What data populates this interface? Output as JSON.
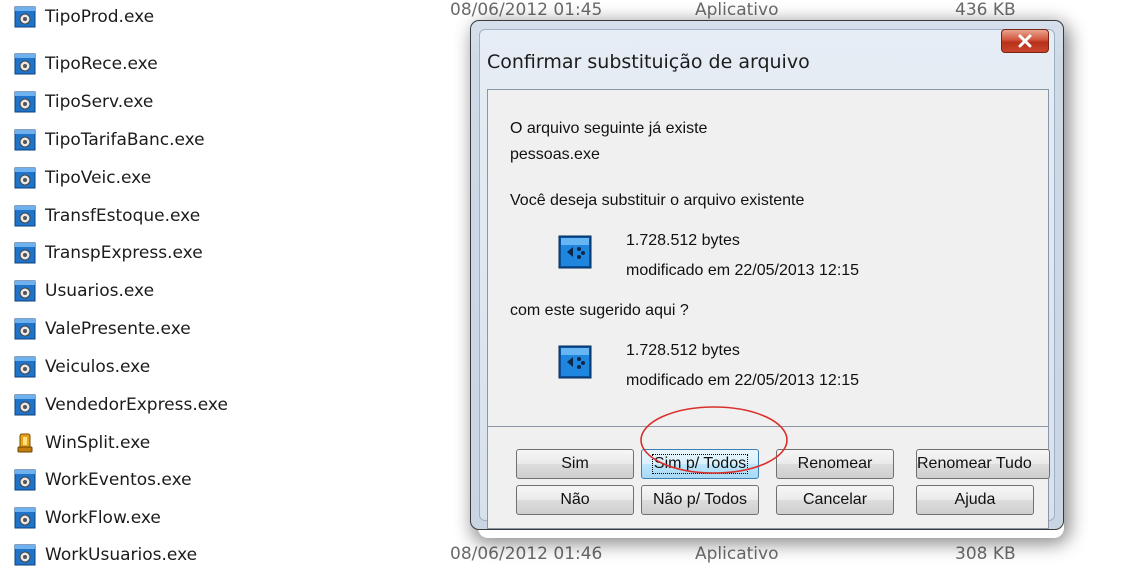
{
  "explorer": {
    "files": [
      {
        "name": "TipoProd.exe",
        "icon": "exe-gear-icon"
      },
      {
        "name": "TipoRece.exe",
        "icon": "exe-gear-icon"
      },
      {
        "name": "TipoServ.exe",
        "icon": "exe-gear-icon"
      },
      {
        "name": "TipoTarifaBanc.exe",
        "icon": "exe-gear-icon"
      },
      {
        "name": "TipoVeic.exe",
        "icon": "exe-gear-icon"
      },
      {
        "name": "TransfEstoque.exe",
        "icon": "exe-gear-icon"
      },
      {
        "name": "TranspExpress.exe",
        "icon": "exe-gear-icon"
      },
      {
        "name": "Usuarios.exe",
        "icon": "exe-gear-icon"
      },
      {
        "name": "ValePresente.exe",
        "icon": "exe-gear-icon"
      },
      {
        "name": "Veiculos.exe",
        "icon": "exe-gear-icon"
      },
      {
        "name": "VendedorExpress.exe",
        "icon": "exe-gear-icon"
      },
      {
        "name": "WinSplit.exe",
        "icon": "winsplit-app-icon"
      },
      {
        "name": "WorkEventos.exe",
        "icon": "exe-gear-icon"
      },
      {
        "name": "WorkFlow.exe",
        "icon": "exe-gear-icon"
      },
      {
        "name": "WorkUsuarios.exe",
        "icon": "exe-gear-icon"
      }
    ],
    "top_detail": {
      "date": "08/06/2012 01:45",
      "type": "Aplicativo",
      "size": "436 KB"
    },
    "bottom_detail": {
      "date": "08/06/2012 01:46",
      "type": "Aplicativo",
      "size": "308 KB"
    }
  },
  "dialog": {
    "title": "Confirmar substituição de arquivo",
    "close_icon": "close-x-icon",
    "line1": "O arquivo seguinte já existe",
    "filename": "pessoas.exe",
    "question": "Você deseja substituir o arquivo existente",
    "existing": {
      "size": "1.728.512 bytes",
      "modified": "modificado em 22/05/2013 12:15"
    },
    "with_text": "com este sugerido aqui ?",
    "suggested": {
      "size": "1.728.512 bytes",
      "modified": "modificado em 22/05/2013 12:15"
    },
    "buttons": {
      "yes": "Sim",
      "yes_all": "Sim p/ Todos",
      "rename": "Renomear",
      "rename_all": "Renomear Tudo",
      "no": "Não",
      "no_all": "Não p/ Todos",
      "cancel": "Cancelar",
      "help": "Ajuda"
    },
    "highlight_color": "#d9302a",
    "focused_button": "yes_all"
  }
}
